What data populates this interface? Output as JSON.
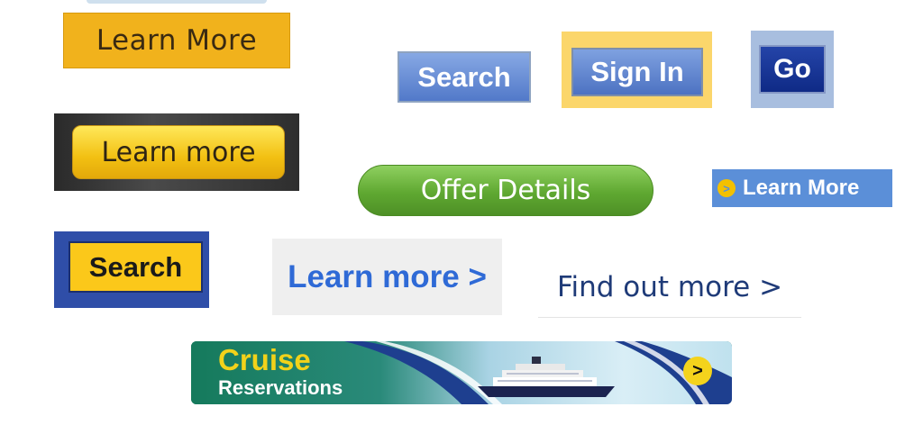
{
  "buttons": {
    "learn_more_gold": "Learn More",
    "search_blue": "Search",
    "sign_in": "Sign In",
    "go": "Go",
    "learn_more_dark": "Learn more",
    "offer_details": "Offer Details",
    "learn_more_blue": "Learn More",
    "search_yellow": "Search",
    "learn_more_link": "Learn more >",
    "find_out_more": "Find out more >"
  },
  "banner": {
    "title": "Cruise",
    "subtitle": "Reservations",
    "arrow_glyph": ">"
  },
  "bullet_glyph": ">",
  "colors": {
    "gold": "#f1b21c",
    "blue": "#5279c9",
    "navy": "#0f2a86",
    "green": "#5fa831",
    "link_blue": "#2f6ad6",
    "yellow": "#fbc81a"
  },
  "icons": {
    "bullet": "circle-chevron-right-icon",
    "banner_arrow": "circle-chevron-right-icon",
    "ship": "cruise-ship-icon"
  }
}
